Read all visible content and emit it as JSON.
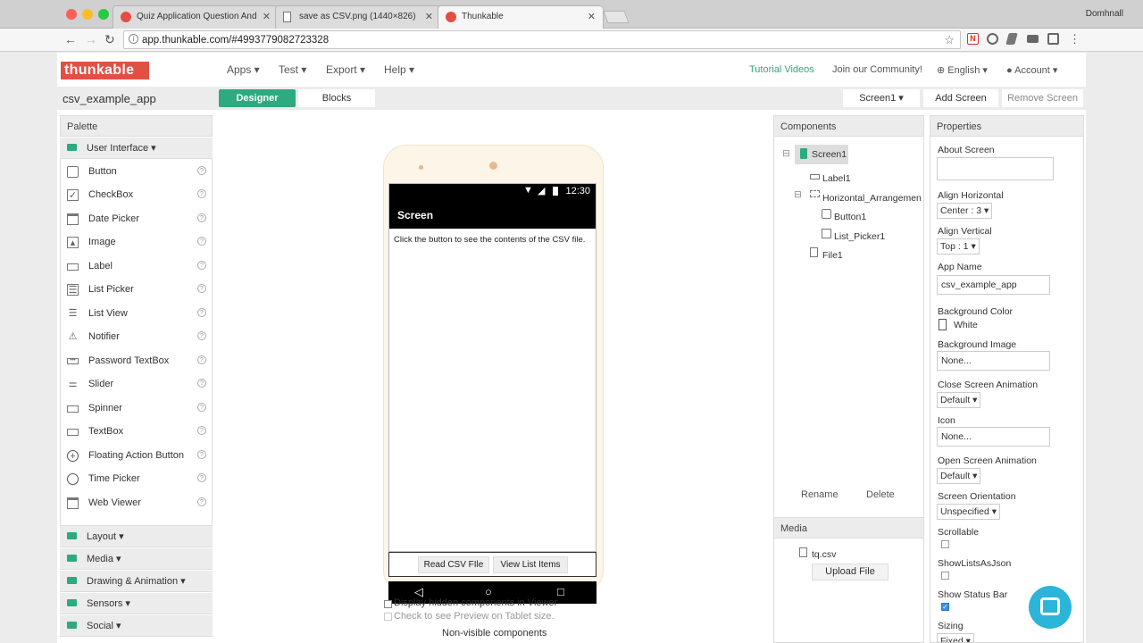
{
  "browser": {
    "tabs": [
      {
        "title": "Quiz Application Question And"
      },
      {
        "title": "save as CSV.png (1440×826)"
      },
      {
        "title": "Thunkable"
      }
    ],
    "profile": "Domhnall",
    "url": "app.thunkable.com/#4993779082723328"
  },
  "nav": {
    "logo": "thunkable",
    "menus": [
      "Apps ▾",
      "Test ▾",
      "Export ▾",
      "Help ▾"
    ],
    "tutorial": "Tutorial Videos",
    "community": "Join our Community!",
    "language": "English ▾",
    "account": "Account ▾"
  },
  "subbar": {
    "app_name": "csv_example_app",
    "designer": "Designer",
    "blocks": "Blocks",
    "screen_select": "Screen1 ▾",
    "add_screen": "Add Screen",
    "remove_screen": "Remove Screen"
  },
  "palette": {
    "title": "Palette",
    "category_open": "User Interface ▾",
    "items": [
      {
        "label": "Button",
        "icon": "button-icon"
      },
      {
        "label": "CheckBox",
        "icon": "checkbox-icon"
      },
      {
        "label": "Date Picker",
        "icon": "calendar-icon"
      },
      {
        "label": "Image",
        "icon": "image-icon"
      },
      {
        "label": "Label",
        "icon": "label-icon"
      },
      {
        "label": "List Picker",
        "icon": "list-picker-icon"
      },
      {
        "label": "List View",
        "icon": "list-view-icon"
      },
      {
        "label": "Notifier",
        "icon": "warning-icon"
      },
      {
        "label": "Password TextBox",
        "icon": "password-icon"
      },
      {
        "label": "Slider",
        "icon": "slider-icon"
      },
      {
        "label": "Spinner",
        "icon": "spinner-icon"
      },
      {
        "label": "TextBox",
        "icon": "textbox-icon"
      },
      {
        "label": "Floating Action Button",
        "icon": "plus-circle-icon"
      },
      {
        "label": "Time Picker",
        "icon": "clock-icon"
      },
      {
        "label": "Web Viewer",
        "icon": "browser-icon"
      }
    ],
    "help": "?",
    "categories": [
      "Layout ▾",
      "Media ▾",
      "Drawing & Animation ▾",
      "Sensors ▾",
      "Social ▾"
    ]
  },
  "viewer": {
    "time": "12:30",
    "screen_title": "Screen",
    "label_text": "Click the button to see the contents of the CSV file.",
    "button1": "Read CSV FIle",
    "button2": "View List Items",
    "display_hidden": "Display hidden components in Viewer",
    "tablet_preview": "Check to see Preview on Tablet size.",
    "non_visible": "Non-visible components"
  },
  "components": {
    "title": "Components",
    "tree": [
      "Screen1",
      "Label1",
      "Horizontal_Arrangemen",
      "Button1",
      "List_Picker1",
      "File1"
    ],
    "rename": "Rename",
    "delete": "Delete"
  },
  "media": {
    "title": "Media",
    "file": "tq.csv",
    "upload": "Upload File"
  },
  "properties": {
    "title": "Properties",
    "about_screen": "About Screen",
    "align_horizontal": "Align Horizontal",
    "align_horizontal_val": "Center : 3 ▾",
    "align_vertical": "Align Vertical",
    "align_vertical_val": "Top : 1 ▾",
    "app_name": "App Name",
    "app_name_val": "csv_example_app",
    "background_color": "Background Color",
    "background_color_val": "White",
    "background_image": "Background Image",
    "background_image_val": "None...",
    "close_anim": "Close Screen Animation",
    "close_anim_val": "Default ▾",
    "icon": "Icon",
    "icon_val": "None...",
    "open_anim": "Open Screen Animation",
    "open_anim_val": "Default ▾",
    "orientation": "Screen Orientation",
    "orientation_val": "Unspecified ▾",
    "scrollable": "Scrollable",
    "show_lists": "ShowListsAsJson",
    "show_status": "Show Status Bar",
    "sizing": "Sizing",
    "sizing_val": "Fixed ▾"
  },
  "colors": {
    "accent": "#2daa80",
    "logo": "#e25044",
    "chat": "#2bb5d8"
  }
}
